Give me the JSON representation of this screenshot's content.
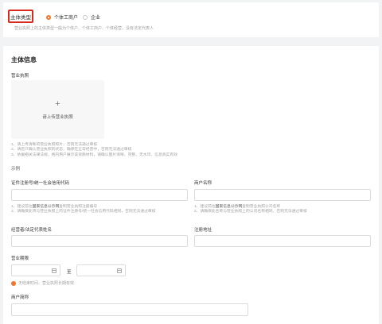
{
  "entity_type": {
    "label": "主体类型",
    "options": [
      {
        "label": "个体工商户",
        "selected": true
      },
      {
        "label": "企业",
        "selected": false
      }
    ],
    "hint": "营业执照上的主体类型一般为个体户、个体工商户、个体经营，没有法定代表人"
  },
  "main_info": {
    "title": "主体信息",
    "license": {
      "label": "营业执照",
      "upload_text": "请上传营业执照",
      "notes": [
        "1、请上传清晰的营业执照照片，否则无法通过审核",
        "2、请您只确认营业执照的状态，确保在正常经营中，否则无法通过审核",
        "3、依据相关法律法规，格内用户展示该资质材料，请确认图片清晰、完整、无水印、信息真实有效"
      ],
      "example": "示例"
    },
    "credit_code": {
      "label": "证件注册号/统一社会信用代码",
      "value": "",
      "notes_prefix": "1、建议前往",
      "notes_link": "国家信息公示网",
      "notes_suffix": "复制营业执照注册编号",
      "notes_2": "2、请确保此项与营业执照上的证件注册号/统一社会信用代码相同，否则无法通过审核"
    },
    "merchant_name": {
      "label": "商户名称",
      "value": "",
      "notes_prefix": "1、建议前往",
      "notes_link": "国家信息公示网",
      "notes_suffix": "复制营业执照公司名称",
      "notes_2": "2、请确保此名称与营业执照上的公司名称相同，否则无法通过审核"
    },
    "operator": {
      "label": "经营者/法定代表姓名",
      "value": ""
    },
    "address": {
      "label": "注册地址",
      "value": ""
    },
    "validity": {
      "label": "营业期限",
      "start": "",
      "separator": "至",
      "end": "",
      "no_expiry_note": "无结束时间、营业执照长期有效"
    },
    "abbreviation": {
      "label": "商户简称",
      "value": ""
    }
  },
  "colors": {
    "accent": "#f0762b",
    "highlight_border": "#d9291c"
  }
}
